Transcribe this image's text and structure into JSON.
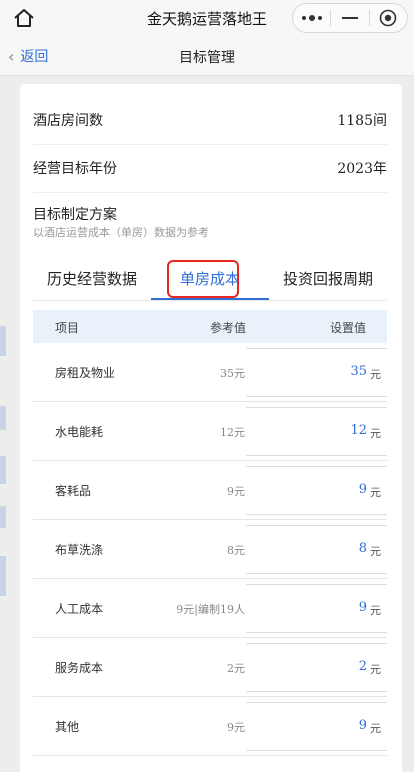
{
  "app": {
    "title": "金天鹅运营落地王"
  },
  "nav": {
    "back_label": "返回",
    "page_title": "目标管理"
  },
  "info": [
    {
      "label": "酒店房间数",
      "value": "1185间"
    },
    {
      "label": "经营目标年份",
      "value": "2023年"
    }
  ],
  "plan": {
    "title": "目标制定方案",
    "subtitle": "以酒店运营成本（单房）数据为参考"
  },
  "tabs": [
    {
      "label": "历史经营数据",
      "active": false
    },
    {
      "label": "单房成本",
      "active": true
    },
    {
      "label": "投资回报周期",
      "active": false
    }
  ],
  "table": {
    "headers": {
      "item": "项目",
      "ref": "参考值",
      "set": "设置值"
    },
    "unit": "元",
    "rows": [
      {
        "name": "房租及物业",
        "ref": "35元",
        "value": "35"
      },
      {
        "name": "水电能耗",
        "ref": "12元",
        "value": "12"
      },
      {
        "name": "客耗品",
        "ref": "9元",
        "value": "9"
      },
      {
        "name": "布草洗涤",
        "ref": "8元",
        "value": "8"
      },
      {
        "name": "人工成本",
        "ref": "9元|编制19人",
        "value": "9"
      },
      {
        "name": "服务成本",
        "ref": "2元",
        "value": "2"
      },
      {
        "name": "其他",
        "ref": "9元",
        "value": "9"
      }
    ]
  },
  "colors": {
    "accent": "#2f6fd6",
    "highlight": "#e8261f",
    "header_bg": "#e9f1fb"
  },
  "icons": {
    "home": "home-icon",
    "more": "more-dots-icon",
    "minimize": "minimize-icon",
    "close": "record-close-icon",
    "back": "chevron-left-icon"
  }
}
